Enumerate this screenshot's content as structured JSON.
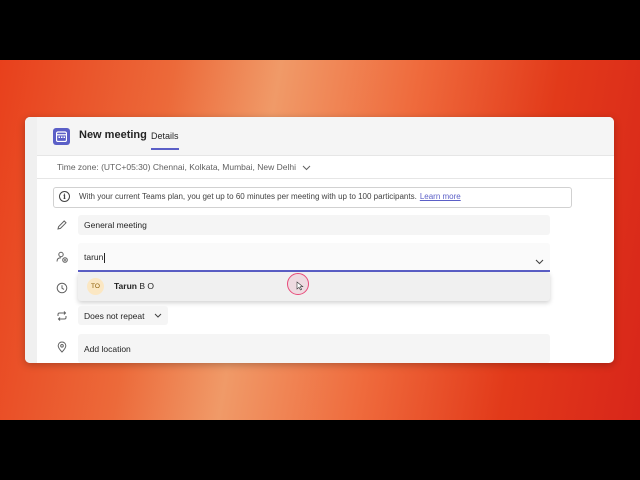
{
  "header": {
    "title": "New meeting",
    "tab_details": "Details"
  },
  "timezone": {
    "label": "Time zone: (UTC+05:30) Chennai, Kolkata, Mumbai, New Delhi"
  },
  "banner": {
    "text": "With your current Teams plan, you get up to 60 minutes per meeting with up to 100 participants.",
    "link": "Learn more"
  },
  "form": {
    "title_value": "General meeting",
    "attendee_value": "tarun",
    "repeat_value": "Does not repeat",
    "location_placeholder": "Add location"
  },
  "suggestion": {
    "initials": "TO",
    "name_bold": "Tarun",
    "name_rest": " B O"
  },
  "colors": {
    "accent": "#5b5fc7",
    "avatar_bg": "#fbe7c3"
  },
  "icons": {
    "calendar": "calendar-icon",
    "info": "info-icon",
    "pencil": "pencil-icon",
    "add_person": "add-person-icon",
    "clock": "clock-icon",
    "repeat": "repeat-icon",
    "location": "location-pin-icon",
    "chevron": "chevron-down-icon"
  }
}
